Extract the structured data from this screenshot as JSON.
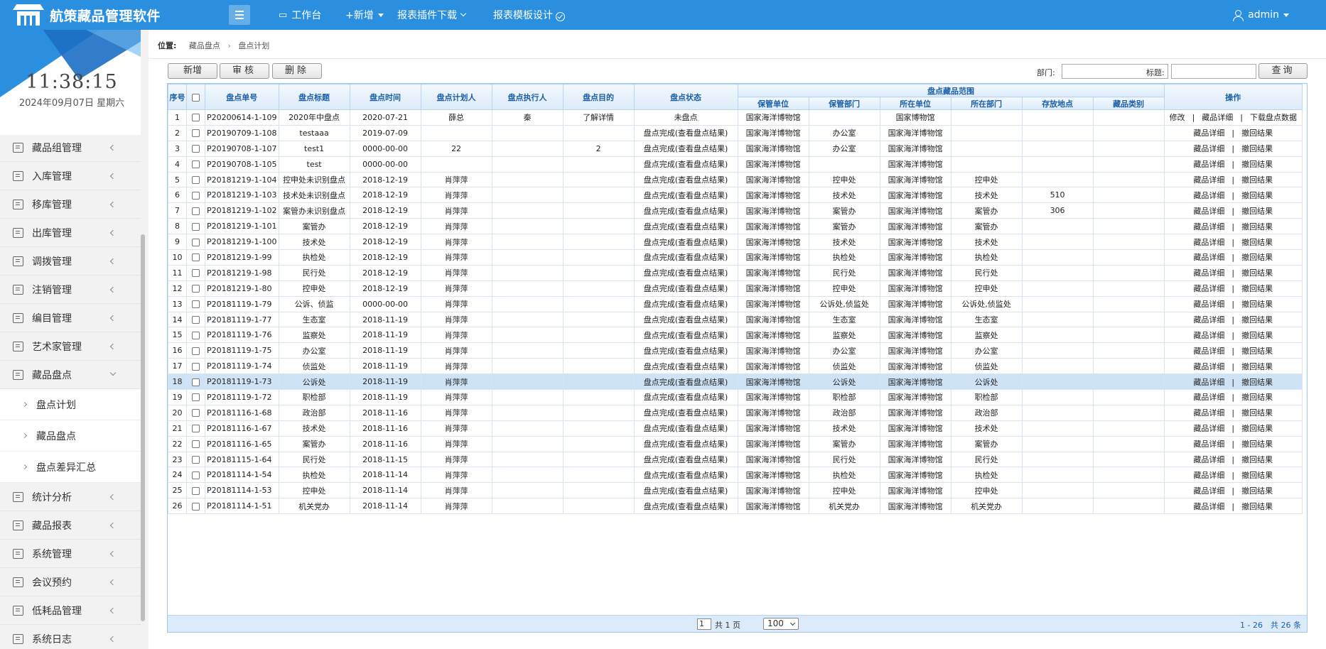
{
  "app": {
    "title": "航策藏品管理软件",
    "user": "admin"
  },
  "topnav": {
    "workbench": "工作台",
    "new": "+新增",
    "report_plugin": "报表插件下载",
    "report_design": "报表模板设计"
  },
  "clock": {
    "time": "11:38:15",
    "date": "2024年09月07日 星期六"
  },
  "sidebar": {
    "items": [
      {
        "label": "藏品组管理",
        "icon": "group-icon"
      },
      {
        "label": "入库管理",
        "icon": "box-in-icon"
      },
      {
        "label": "移库管理",
        "icon": "move-icon"
      },
      {
        "label": "出库管理",
        "icon": "box-out-icon"
      },
      {
        "label": "调拨管理",
        "icon": "transfer-icon"
      },
      {
        "label": "注销管理",
        "icon": "close-icon"
      },
      {
        "label": "编目管理",
        "icon": "list-icon"
      },
      {
        "label": "艺术家管理",
        "icon": "artist-icon"
      },
      {
        "label": "藏品盘点",
        "icon": "table-icon"
      }
    ],
    "subitems": [
      "盘点计划",
      "藏品盘点",
      "盘点差异汇总"
    ],
    "items_after": [
      {
        "label": "统计分析",
        "icon": "chart-icon"
      },
      {
        "label": "藏品报表",
        "icon": "calendar-icon"
      },
      {
        "label": "系统管理",
        "icon": "gear-icon"
      },
      {
        "label": "会议预约",
        "icon": "meeting-icon"
      },
      {
        "label": "低耗品管理",
        "icon": "cube-icon"
      },
      {
        "label": "系统日志",
        "icon": "log-icon"
      }
    ]
  },
  "breadcrumb": {
    "label": "位置:",
    "items": [
      "藏品盘点",
      "盘点计划"
    ]
  },
  "toolbar": {
    "add": "新增",
    "review": "审核",
    "delete": "删除",
    "dept_label": "部门:",
    "title_label": "标题:",
    "query": "查询"
  },
  "table": {
    "headers": {
      "seq": "序号",
      "no": "盘点单号",
      "title": "盘点标题",
      "time": "盘点时间",
      "planner": "盘点计划人",
      "executor": "盘点执行人",
      "purpose": "盘点目的",
      "status": "盘点状态",
      "scope": "盘点藏品范围",
      "keep_unit": "保管单位",
      "keep_dept": "保管部门",
      "unit": "所在单位",
      "dept": "所在部门",
      "location": "存放地点",
      "category": "藏品类别",
      "ops": "操作"
    },
    "rows": [
      {
        "seq": "1",
        "no": "P20200614-1-109",
        "title": "2020年中盘点",
        "time": "2020-07-21",
        "planner": "薛总",
        "executor": "秦",
        "purpose": "了解详情",
        "status": "未盘点",
        "keep_unit": "国家海洋博物馆",
        "keep_dept": "",
        "unit": "国家博物馆",
        "dept": "",
        "location": "",
        "category": "",
        "ops": [
          "修改",
          "藏品详细",
          "下载盘点数据"
        ]
      },
      {
        "seq": "2",
        "no": "P20190709-1-108",
        "title": "testaaa",
        "time": "2019-07-09",
        "planner": "",
        "executor": "",
        "purpose": "",
        "status": "盘点完成(查看盘点结果)",
        "keep_unit": "国家海洋博物馆",
        "keep_dept": "办公室",
        "unit": "国家海洋博物馆",
        "dept": "",
        "location": "",
        "category": "",
        "ops": [
          "藏品详细",
          "撤回结果"
        ]
      },
      {
        "seq": "3",
        "no": "P20190708-1-107",
        "title": "test1",
        "time": "0000-00-00",
        "planner": "22",
        "executor": "",
        "purpose": "2",
        "status": "盘点完成(查看盘点结果)",
        "keep_unit": "国家海洋博物馆",
        "keep_dept": "办公室",
        "unit": "国家海洋博物馆",
        "dept": "",
        "location": "",
        "category": "",
        "ops": [
          "藏品详细",
          "撤回结果"
        ]
      },
      {
        "seq": "4",
        "no": "P20190708-1-105",
        "title": "test",
        "time": "0000-00-00",
        "planner": "",
        "executor": "",
        "purpose": "",
        "status": "盘点完成(查看盘点结果)",
        "keep_unit": "国家海洋博物馆",
        "keep_dept": "",
        "unit": "国家海洋博物馆",
        "dept": "",
        "location": "",
        "category": "",
        "ops": [
          "藏品详细",
          "撤回结果"
        ]
      },
      {
        "seq": "5",
        "no": "P20181219-1-104",
        "title": "控申处未识别盘点",
        "time": "2018-12-19",
        "planner": "肖萍萍",
        "executor": "",
        "purpose": "",
        "status": "盘点完成(查看盘点结果)",
        "keep_unit": "国家海洋博物馆",
        "keep_dept": "控申处",
        "unit": "国家海洋博物馆",
        "dept": "控申处",
        "location": "",
        "category": "",
        "ops": [
          "藏品详细",
          "撤回结果"
        ]
      },
      {
        "seq": "6",
        "no": "P20181219-1-103",
        "title": "技术处未识别盘点",
        "time": "2018-12-19",
        "planner": "肖萍萍",
        "executor": "",
        "purpose": "",
        "status": "盘点完成(查看盘点结果)",
        "keep_unit": "国家海洋博物馆",
        "keep_dept": "技术处",
        "unit": "国家海洋博物馆",
        "dept": "技术处",
        "location": "510",
        "category": "",
        "ops": [
          "藏品详细",
          "撤回结果"
        ]
      },
      {
        "seq": "7",
        "no": "P20181219-1-102",
        "title": "案管办未识别盘点",
        "time": "2018-12-19",
        "planner": "肖萍萍",
        "executor": "",
        "purpose": "",
        "status": "盘点完成(查看盘点结果)",
        "keep_unit": "国家海洋博物馆",
        "keep_dept": "案管办",
        "unit": "国家海洋博物馆",
        "dept": "案管办",
        "location": "306",
        "category": "",
        "ops": [
          "藏品详细",
          "撤回结果"
        ]
      },
      {
        "seq": "8",
        "no": "P20181219-1-101",
        "title": "案管办",
        "time": "2018-12-19",
        "planner": "肖萍萍",
        "executor": "",
        "purpose": "",
        "status": "盘点完成(查看盘点结果)",
        "keep_unit": "国家海洋博物馆",
        "keep_dept": "案管办",
        "unit": "国家海洋博物馆",
        "dept": "案管办",
        "location": "",
        "category": "",
        "ops": [
          "藏品详细",
          "撤回结果"
        ]
      },
      {
        "seq": "9",
        "no": "P20181219-1-100",
        "title": "技术处",
        "time": "2018-12-19",
        "planner": "肖萍萍",
        "executor": "",
        "purpose": "",
        "status": "盘点完成(查看盘点结果)",
        "keep_unit": "国家海洋博物馆",
        "keep_dept": "技术处",
        "unit": "国家海洋博物馆",
        "dept": "技术处",
        "location": "",
        "category": "",
        "ops": [
          "藏品详细",
          "撤回结果"
        ]
      },
      {
        "seq": "10",
        "no": "P20181219-1-99",
        "title": "执检处",
        "time": "2018-12-19",
        "planner": "肖萍萍",
        "executor": "",
        "purpose": "",
        "status": "盘点完成(查看盘点结果)",
        "keep_unit": "国家海洋博物馆",
        "keep_dept": "执检处",
        "unit": "国家海洋博物馆",
        "dept": "执检处",
        "location": "",
        "category": "",
        "ops": [
          "藏品详细",
          "撤回结果"
        ]
      },
      {
        "seq": "11",
        "no": "P20181219-1-98",
        "title": "民行处",
        "time": "2018-12-19",
        "planner": "肖萍萍",
        "executor": "",
        "purpose": "",
        "status": "盘点完成(查看盘点结果)",
        "keep_unit": "国家海洋博物馆",
        "keep_dept": "民行处",
        "unit": "国家海洋博物馆",
        "dept": "民行处",
        "location": "",
        "category": "",
        "ops": [
          "藏品详细",
          "撤回结果"
        ]
      },
      {
        "seq": "12",
        "no": "P20181219-1-80",
        "title": "控申处",
        "time": "2018-12-19",
        "planner": "肖萍萍",
        "executor": "",
        "purpose": "",
        "status": "盘点完成(查看盘点结果)",
        "keep_unit": "国家海洋博物馆",
        "keep_dept": "控申处",
        "unit": "国家海洋博物馆",
        "dept": "控申处",
        "location": "",
        "category": "",
        "ops": [
          "藏品详细",
          "撤回结果"
        ]
      },
      {
        "seq": "13",
        "no": "P20181119-1-79",
        "title": "公诉、侦监",
        "time": "0000-00-00",
        "planner": "肖萍萍",
        "executor": "",
        "purpose": "",
        "status": "盘点完成(查看盘点结果)",
        "keep_unit": "国家海洋博物馆",
        "keep_dept": "公诉处,侦监处",
        "unit": "国家海洋博物馆",
        "dept": "公诉处,侦监处",
        "location": "",
        "category": "",
        "ops": [
          "藏品详细",
          "撤回结果"
        ]
      },
      {
        "seq": "14",
        "no": "P20181119-1-77",
        "title": "生态室",
        "time": "2018-11-19",
        "planner": "肖萍萍",
        "executor": "",
        "purpose": "",
        "status": "盘点完成(查看盘点结果)",
        "keep_unit": "国家海洋博物馆",
        "keep_dept": "生态室",
        "unit": "国家海洋博物馆",
        "dept": "生态室",
        "location": "",
        "category": "",
        "ops": [
          "藏品详细",
          "撤回结果"
        ]
      },
      {
        "seq": "15",
        "no": "P20181119-1-76",
        "title": "监察处",
        "time": "2018-11-19",
        "planner": "肖萍萍",
        "executor": "",
        "purpose": "",
        "status": "盘点完成(查看盘点结果)",
        "keep_unit": "国家海洋博物馆",
        "keep_dept": "监察处",
        "unit": "国家海洋博物馆",
        "dept": "监察处",
        "location": "",
        "category": "",
        "ops": [
          "藏品详细",
          "撤回结果"
        ]
      },
      {
        "seq": "16",
        "no": "P20181119-1-75",
        "title": "办公室",
        "time": "2018-11-19",
        "planner": "肖萍萍",
        "executor": "",
        "purpose": "",
        "status": "盘点完成(查看盘点结果)",
        "keep_unit": "国家海洋博物馆",
        "keep_dept": "办公室",
        "unit": "国家海洋博物馆",
        "dept": "办公室",
        "location": "",
        "category": "",
        "ops": [
          "藏品详细",
          "撤回结果"
        ]
      },
      {
        "seq": "17",
        "no": "P20181119-1-74",
        "title": "侦监处",
        "time": "2018-11-19",
        "planner": "肖萍萍",
        "executor": "",
        "purpose": "",
        "status": "盘点完成(查看盘点结果)",
        "keep_unit": "国家海洋博物馆",
        "keep_dept": "侦监处",
        "unit": "国家海洋博物馆",
        "dept": "侦监处",
        "location": "",
        "category": "",
        "ops": [
          "藏品详细",
          "撤回结果"
        ]
      },
      {
        "seq": "18",
        "no": "P20181119-1-73",
        "title": "公诉处",
        "time": "2018-11-19",
        "planner": "肖萍萍",
        "executor": "",
        "purpose": "",
        "status": "盘点完成(查看盘点结果)",
        "keep_unit": "国家海洋博物馆",
        "keep_dept": "公诉处",
        "unit": "国家海洋博物馆",
        "dept": "公诉处",
        "location": "",
        "category": "",
        "ops": [
          "藏品详细",
          "撤回结果"
        ],
        "selected": true
      },
      {
        "seq": "19",
        "no": "P20181119-1-72",
        "title": "职检部",
        "time": "2018-11-19",
        "planner": "肖萍萍",
        "executor": "",
        "purpose": "",
        "status": "盘点完成(查看盘点结果)",
        "keep_unit": "国家海洋博物馆",
        "keep_dept": "职检部",
        "unit": "国家海洋博物馆",
        "dept": "职检部",
        "location": "",
        "category": "",
        "ops": [
          "藏品详细",
          "撤回结果"
        ]
      },
      {
        "seq": "20",
        "no": "P20181116-1-68",
        "title": "政治部",
        "time": "2018-11-16",
        "planner": "肖萍萍",
        "executor": "",
        "purpose": "",
        "status": "盘点完成(查看盘点结果)",
        "keep_unit": "国家海洋博物馆",
        "keep_dept": "政治部",
        "unit": "国家海洋博物馆",
        "dept": "政治部",
        "location": "",
        "category": "",
        "ops": [
          "藏品详细",
          "撤回结果"
        ]
      },
      {
        "seq": "21",
        "no": "P20181116-1-67",
        "title": "技术处",
        "time": "2018-11-16",
        "planner": "肖萍萍",
        "executor": "",
        "purpose": "",
        "status": "盘点完成(查看盘点结果)",
        "keep_unit": "国家海洋博物馆",
        "keep_dept": "技术处",
        "unit": "国家海洋博物馆",
        "dept": "技术处",
        "location": "",
        "category": "",
        "ops": [
          "藏品详细",
          "撤回结果"
        ]
      },
      {
        "seq": "22",
        "no": "P20181116-1-65",
        "title": "案管办",
        "time": "2018-11-16",
        "planner": "肖萍萍",
        "executor": "",
        "purpose": "",
        "status": "盘点完成(查看盘点结果)",
        "keep_unit": "国家海洋博物馆",
        "keep_dept": "案管办",
        "unit": "国家海洋博物馆",
        "dept": "案管办",
        "location": "",
        "category": "",
        "ops": [
          "藏品详细",
          "撤回结果"
        ]
      },
      {
        "seq": "23",
        "no": "P20181115-1-64",
        "title": "民行处",
        "time": "2018-11-15",
        "planner": "肖萍萍",
        "executor": "",
        "purpose": "",
        "status": "盘点完成(查看盘点结果)",
        "keep_unit": "国家海洋博物馆",
        "keep_dept": "民行处",
        "unit": "国家海洋博物馆",
        "dept": "民行处",
        "location": "",
        "category": "",
        "ops": [
          "藏品详细",
          "撤回结果"
        ]
      },
      {
        "seq": "24",
        "no": "P20181114-1-54",
        "title": "执检处",
        "time": "2018-11-14",
        "planner": "肖萍萍",
        "executor": "",
        "purpose": "",
        "status": "盘点完成(查看盘点结果)",
        "keep_unit": "国家海洋博物馆",
        "keep_dept": "执检处",
        "unit": "国家海洋博物馆",
        "dept": "执检处",
        "location": "",
        "category": "",
        "ops": [
          "藏品详细",
          "撤回结果"
        ]
      },
      {
        "seq": "25",
        "no": "P20181114-1-53",
        "title": "控申处",
        "time": "2018-11-14",
        "planner": "肖萍萍",
        "executor": "",
        "purpose": "",
        "status": "盘点完成(查看盘点结果)",
        "keep_unit": "国家海洋博物馆",
        "keep_dept": "控申处",
        "unit": "国家海洋博物馆",
        "dept": "控申处",
        "location": "",
        "category": "",
        "ops": [
          "藏品详细",
          "撤回结果"
        ]
      },
      {
        "seq": "26",
        "no": "P20181114-1-51",
        "title": "机关党办",
        "time": "2018-11-14",
        "planner": "肖萍萍",
        "executor": "",
        "purpose": "",
        "status": "盘点完成(查看盘点结果)",
        "keep_unit": "国家海洋博物馆",
        "keep_dept": "机关党办",
        "unit": "国家海洋博物馆",
        "dept": "机关党办",
        "location": "",
        "category": "",
        "ops": [
          "藏品详细",
          "撤回结果"
        ]
      }
    ]
  },
  "pager": {
    "page": "1",
    "total_pages": "共 1 页",
    "page_size": "100",
    "info": "1 - 26　共 26 条"
  },
  "colors": {
    "topbar": "#2b8fe0",
    "header_text": "#1b5fa8",
    "highlight_row": "#cfe3f6",
    "unchecked_status": "#e02020"
  }
}
